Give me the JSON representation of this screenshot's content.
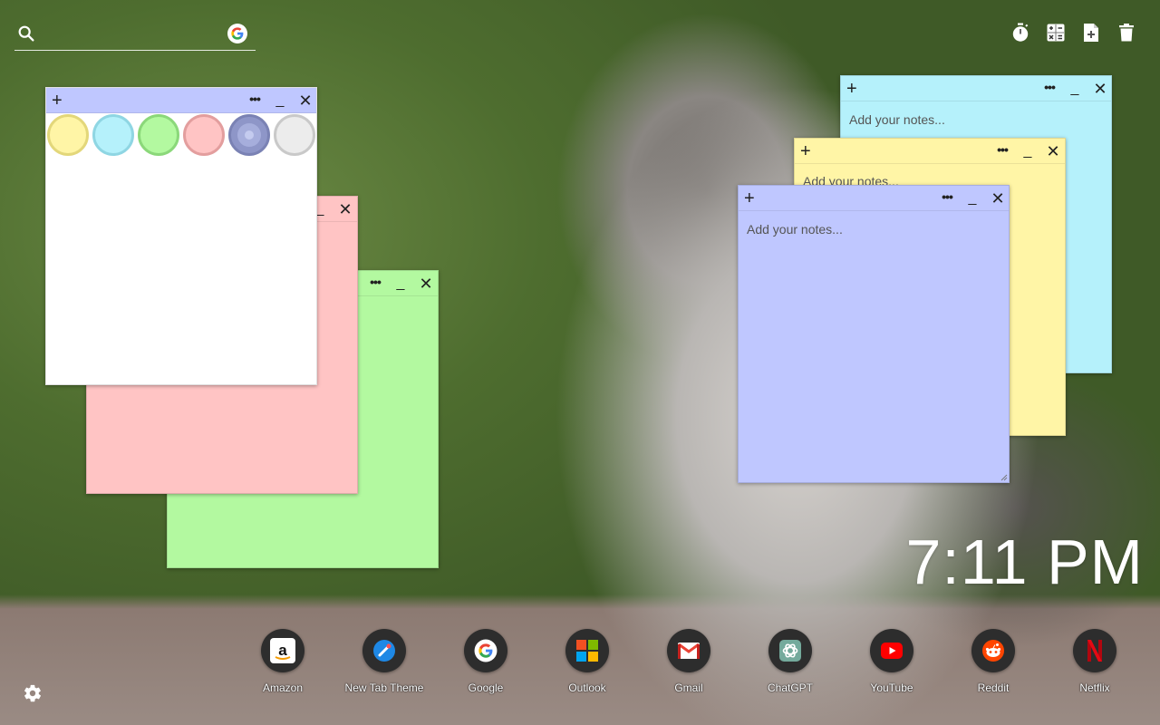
{
  "search": {
    "placeholder": "",
    "engine_icon": "google-icon"
  },
  "toolbar": {
    "buttons": [
      "timer-icon",
      "calculator-icon",
      "new-note-icon",
      "trash-icon"
    ]
  },
  "notes": {
    "placeholder": "Add your notes...",
    "add_label": "+",
    "more_label": "•••",
    "min_label": "_",
    "close_label": "✕",
    "colors": {
      "white": "#ffffff",
      "pink": "#ffc4c4",
      "green": "#b3f9a0",
      "cyan": "#b5f1fb",
      "yellow": "#fff5a6",
      "lavender": "#bfc7ff"
    },
    "picker_swatches": [
      {
        "name": "yellow",
        "fill": "#fff5a6",
        "border": "#e3d77a"
      },
      {
        "name": "cyan",
        "fill": "#b5f1fb",
        "border": "#8fd6e3"
      },
      {
        "name": "green",
        "fill": "#b3f9a0",
        "border": "#8bd87a"
      },
      {
        "name": "pink",
        "fill": "#ffc4c4",
        "border": "#e39e9e"
      },
      {
        "name": "lavender",
        "fill": "#8e96c8",
        "border": "#7a82b4"
      },
      {
        "name": "gray",
        "fill": "#ececec",
        "border": "#c9c9c9"
      }
    ]
  },
  "clock": {
    "time": "7:11 PM"
  },
  "shortcuts": [
    {
      "label": "Amazon",
      "icon": "amazon-icon"
    },
    {
      "label": "New Tab Theme",
      "icon": "new-tab-theme-icon"
    },
    {
      "label": "Google",
      "icon": "google-icon"
    },
    {
      "label": "Outlook",
      "icon": "microsoft-icon"
    },
    {
      "label": "Gmail",
      "icon": "gmail-icon"
    },
    {
      "label": "ChatGPT",
      "icon": "chatgpt-icon"
    },
    {
      "label": "YouTube",
      "icon": "youtube-icon"
    },
    {
      "label": "Reddit",
      "icon": "reddit-icon"
    },
    {
      "label": "Netflix",
      "icon": "netflix-icon"
    }
  ],
  "settings": {
    "icon": "gear-icon"
  }
}
